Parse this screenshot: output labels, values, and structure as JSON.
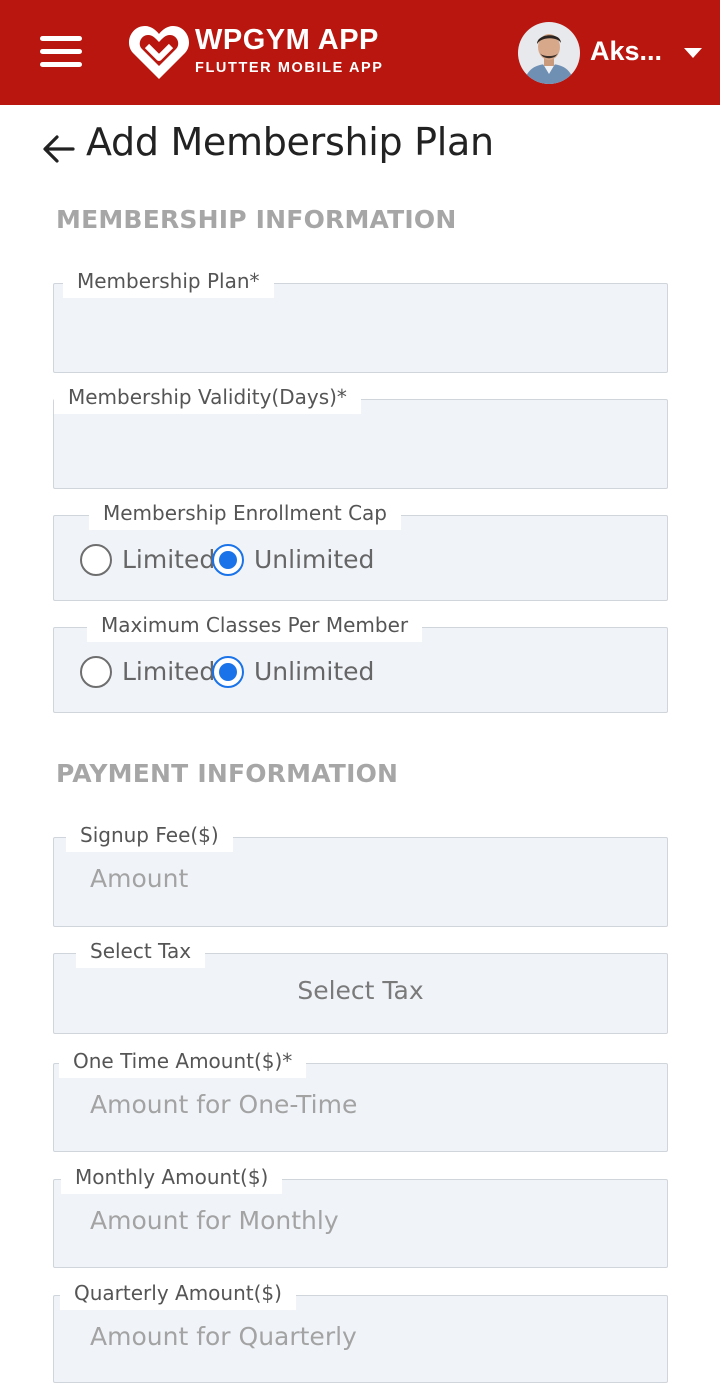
{
  "header": {
    "brand_title": "WPGYM APP",
    "brand_subtitle": "FLUTTER MOBILE APP",
    "user_name": "Aks...",
    "menu_icon": "hamburger-menu-icon",
    "dropdown_icon": "caret-down-icon",
    "accent_color": "#b8160e"
  },
  "page": {
    "back_icon": "arrow-left-icon",
    "title": "Add Membership Plan"
  },
  "sections": {
    "membership": "MEMBERSHIP INFORMATION",
    "payment": "PAYMENT INFORMATION"
  },
  "fields": {
    "membership_plan": {
      "label": "Membership Plan*",
      "value": ""
    },
    "validity": {
      "label": "Membership Validity(Days)*",
      "value": ""
    },
    "enrollment_cap": {
      "label": "Membership Enrollment Cap",
      "options": [
        "Limited",
        "Unlimited"
      ],
      "selected": "Unlimited"
    },
    "max_classes": {
      "label": "Maximum Classes Per Member",
      "options": [
        "Limited",
        "Unlimited"
      ],
      "selected": "Unlimited"
    },
    "signup_fee": {
      "label": "Signup Fee($)",
      "placeholder": "Amount"
    },
    "tax": {
      "label": "Select Tax",
      "value": "Select Tax"
    },
    "one_time": {
      "label": "One Time Amount($)*",
      "placeholder": "Amount for One-Time"
    },
    "monthly": {
      "label": "Monthly Amount($)",
      "placeholder": "Amount for Monthly"
    },
    "quarterly": {
      "label": "Quarterly Amount($)",
      "placeholder": "Amount for Quarterly"
    }
  },
  "colors": {
    "radio_selected": "#1a73e8",
    "field_background": "#f0f4f9"
  }
}
